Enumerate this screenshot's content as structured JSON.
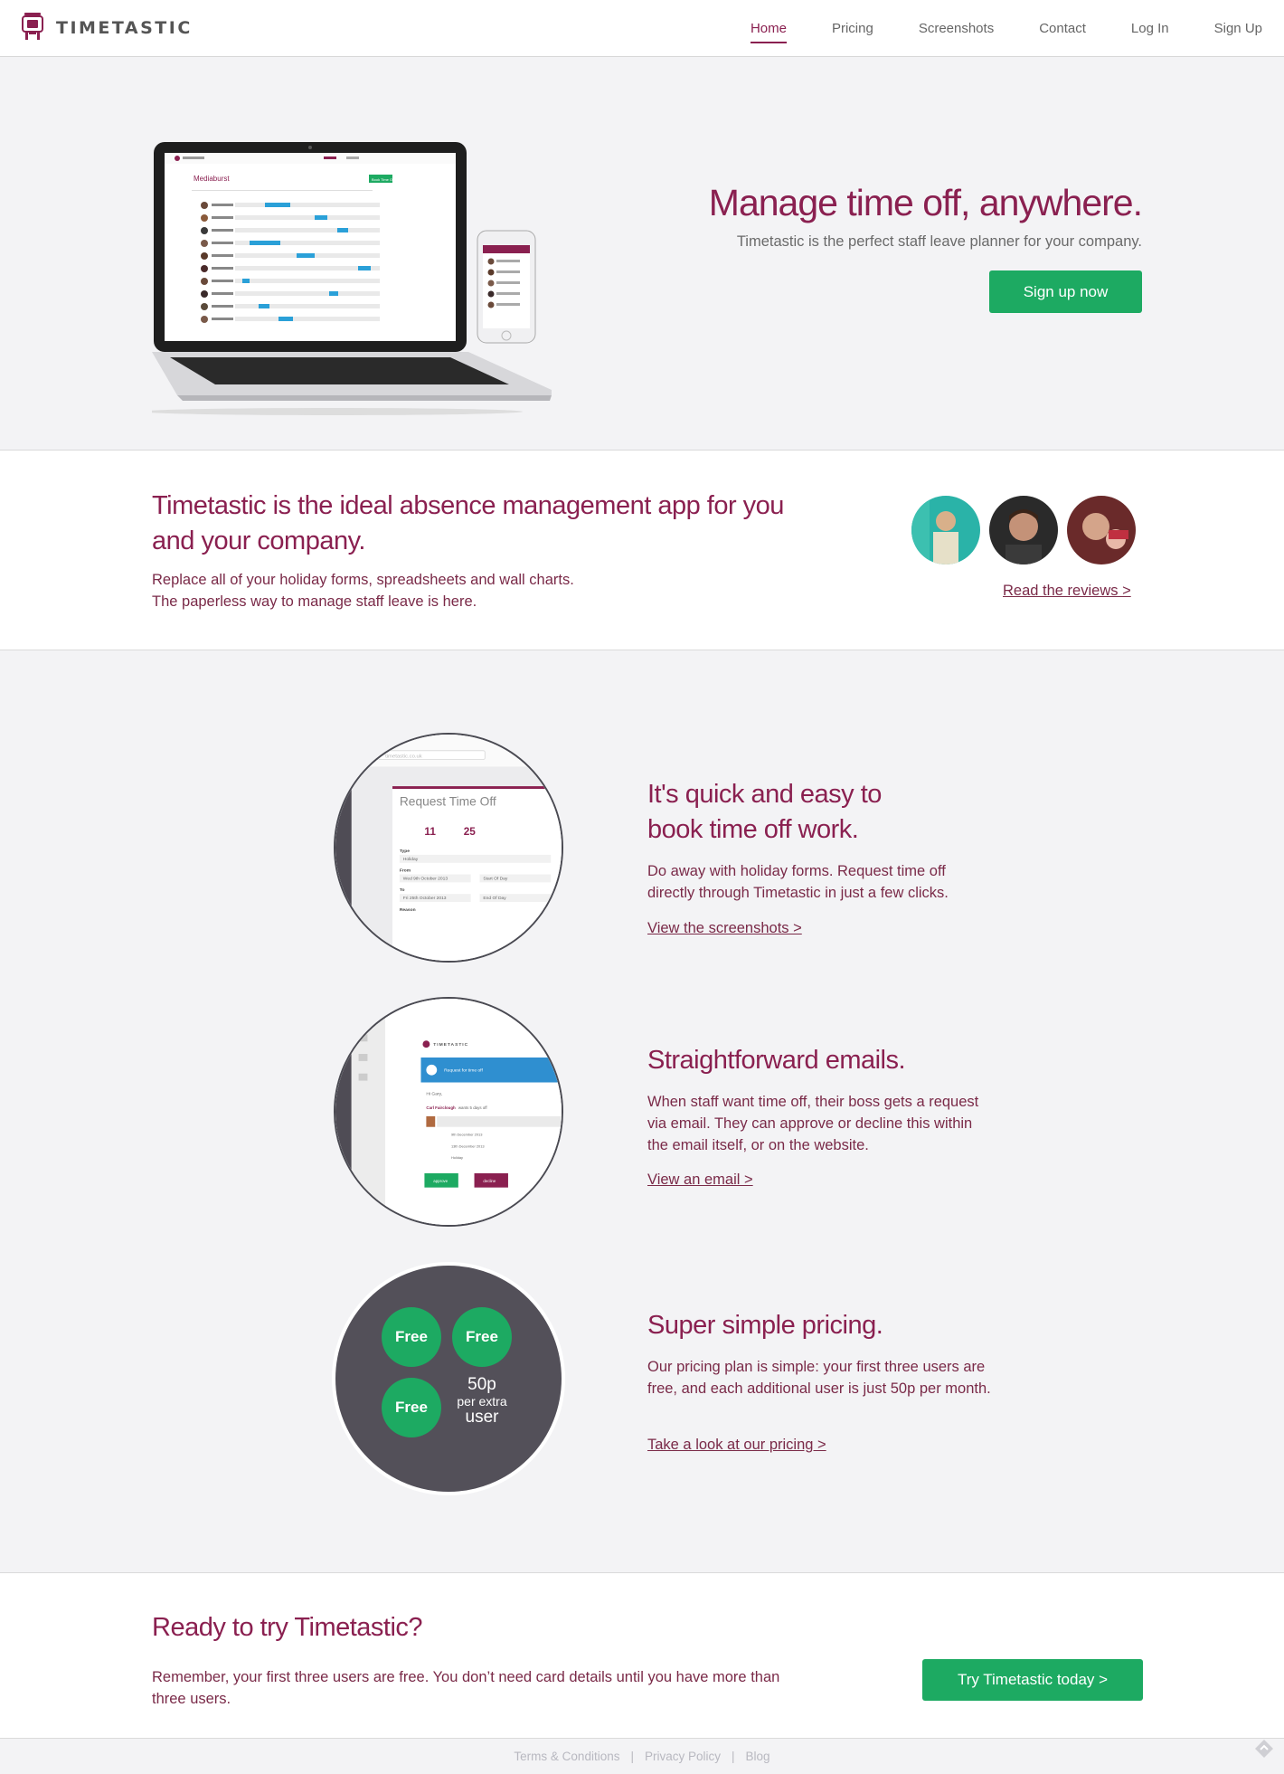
{
  "brand": {
    "name": "TIMETASTIC"
  },
  "nav": {
    "items": [
      {
        "label": "Home",
        "active": true
      },
      {
        "label": "Pricing",
        "active": false
      },
      {
        "label": "Screenshots",
        "active": false
      },
      {
        "label": "Contact",
        "active": false
      },
      {
        "label": "Log In",
        "active": false
      },
      {
        "label": "Sign Up",
        "active": false
      }
    ]
  },
  "hero": {
    "title": "Manage time off, anywhere.",
    "subtitle": "Timetastic is the perfect staff leave planner for your company.",
    "cta_label": "Sign up now",
    "laptop_screen": {
      "company": "Mediaburst",
      "button": "Book Time Off"
    }
  },
  "intro": {
    "title": "Timetastic is the ideal absence management app for you and your company.",
    "line1": "Replace all of your holiday forms, spreadsheets and wall charts.",
    "line2": "The paperless way to manage staff leave is here.",
    "reviews_link": "Read the reviews >"
  },
  "features": [
    {
      "title_line1": "It's quick and easy to",
      "title_line2": "book time off work.",
      "text": "Do away with holiday forms. Request time off directly through Timetastic in just a few clicks.",
      "link": "View the screenshots >",
      "mock": {
        "url": "timetastic.co.uk",
        "heading": "Request Time Off",
        "day_from": "11",
        "day_to": "25",
        "type_label": "Type",
        "type_value": "Holiday",
        "from_label": "From",
        "from_value": "Wed 9th October 2013",
        "from_part": "Start Of Day",
        "to_label": "To",
        "to_value": "Fri 25th October 2013",
        "to_part": "End Of Day",
        "reason_label": "Reason"
      }
    },
    {
      "title_line1": "Straightforward emails.",
      "text": "When staff want time off, their boss gets a request via email. They can approve or decline this within the email itself, or on the website.",
      "link": "View an email >",
      "mock": {
        "brand": "TIMETASTIC",
        "header": "Request for time off",
        "greeting": "Hi Gary,",
        "requester": "Carl Fairclough",
        "wants": "wants 5 days off",
        "date_from": "9th December 2013",
        "date_to": "13th December 2013",
        "type": "Holiday",
        "approve": "approve",
        "decline": "decline"
      }
    },
    {
      "title_line1": "Super simple pricing.",
      "text": "Our pricing plan is simple: your first three users are free, and each additional user is just 50p per month.",
      "link": "Take a look at our pricing >",
      "circle": {
        "free1": "Free",
        "free2": "Free",
        "free3": "Free",
        "extra_amount": "50p",
        "extra_line1": "per extra",
        "extra_line2": "user"
      }
    }
  ],
  "cta": {
    "title": "Ready to try Timetastic?",
    "text": "Remember, your first three users are free. You don’t need card details until you have more than three users.",
    "button": "Try Timetastic today >"
  },
  "footer": {
    "links": [
      "Terms & Conditions",
      "Privacy Policy",
      "Blog"
    ],
    "separator": "|"
  },
  "colors": {
    "brand": "#8a2050",
    "green": "#1daa62",
    "background": "#f3f3f5",
    "dark_circle": "#535059"
  }
}
